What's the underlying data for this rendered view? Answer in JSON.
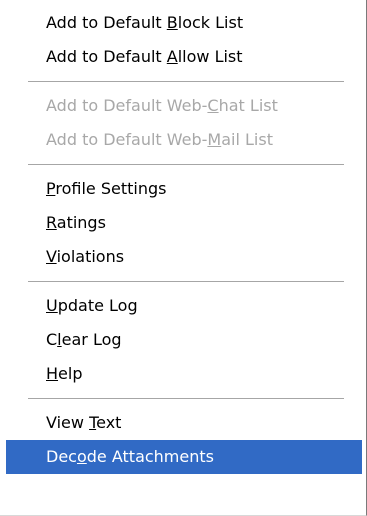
{
  "menu": {
    "groups": [
      {
        "items": [
          {
            "pre": "Add to Default ",
            "key": "B",
            "post": "lock List",
            "enabled": true
          },
          {
            "pre": "Add to Default ",
            "key": "A",
            "post": "llow List",
            "enabled": true
          }
        ]
      },
      {
        "items": [
          {
            "pre": "Add to Default Web-",
            "key": "C",
            "post": "hat List",
            "enabled": false
          },
          {
            "pre": "Add to Default Web-",
            "key": "M",
            "post": "ail List",
            "enabled": false
          }
        ]
      },
      {
        "items": [
          {
            "pre": "",
            "key": "P",
            "post": "rofile Settings",
            "enabled": true
          },
          {
            "pre": "",
            "key": "R",
            "post": "atings",
            "enabled": true
          },
          {
            "pre": "",
            "key": "V",
            "post": "iolations",
            "enabled": true
          }
        ]
      },
      {
        "items": [
          {
            "pre": "",
            "key": "U",
            "post": "pdate Log",
            "enabled": true
          },
          {
            "pre": "C",
            "key": "l",
            "post": "ear Log",
            "enabled": true
          },
          {
            "pre": "",
            "key": "H",
            "post": "elp",
            "enabled": true
          }
        ]
      },
      {
        "items": [
          {
            "pre": "View ",
            "key": "T",
            "post": "ext",
            "enabled": true
          },
          {
            "pre": "Dec",
            "key": "o",
            "post": "de Attachments",
            "enabled": true,
            "selected": true
          }
        ]
      }
    ]
  },
  "colors": {
    "highlight": "#316ac5",
    "disabled_text": "#a8a8a8",
    "separator": "#a6a6a6"
  }
}
